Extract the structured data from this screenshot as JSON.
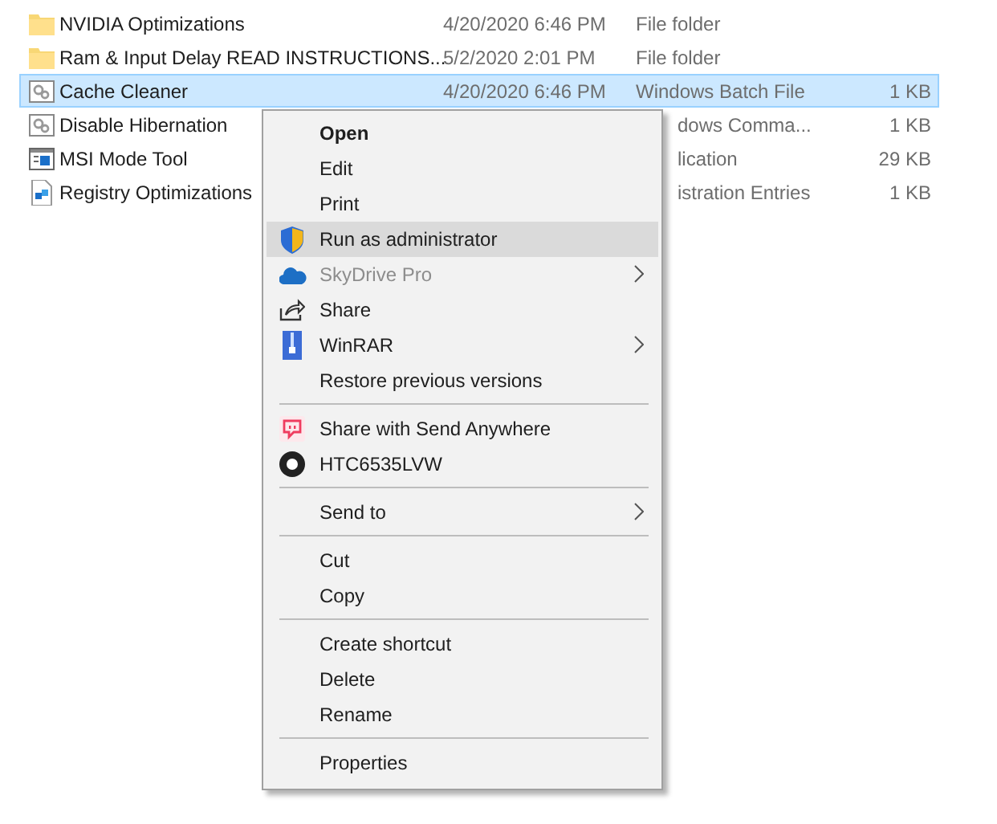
{
  "files": [
    {
      "name": "NVIDIA Optimizations",
      "date": "4/20/2020 6:46 PM",
      "type": "File folder",
      "selected": false
    },
    {
      "name": "Ram & Input Delay READ INSTRUCTIONS...",
      "date": "5/2/2020 2:01 PM",
      "type": "File folder",
      "selected": false
    },
    {
      "name": "Cache Cleaner",
      "date": "4/20/2020 6:46 PM",
      "type": "Windows Batch File",
      "size": "1 KB",
      "selected": true
    },
    {
      "name": "Disable Hibernation",
      "type": "dows Comma...",
      "size": "1 KB",
      "selected": false
    },
    {
      "name": "MSI Mode Tool",
      "type": "lication",
      "size": "29 KB",
      "selected": false
    },
    {
      "name": "Registry Optimizations",
      "type": "istration Entries",
      "size": "1 KB",
      "selected": false
    }
  ],
  "context_menu": {
    "items": [
      {
        "kind": "item",
        "label": "Open",
        "bold": true,
        "highlighted": false,
        "disabled": false,
        "submenu": false
      },
      {
        "kind": "item",
        "label": "Edit",
        "bold": false,
        "highlighted": false,
        "disabled": false,
        "submenu": false
      },
      {
        "kind": "item",
        "label": "Print",
        "bold": false,
        "highlighted": false,
        "disabled": false,
        "submenu": false
      },
      {
        "kind": "item",
        "label": "Run as administrator",
        "bold": false,
        "highlighted": true,
        "disabled": false,
        "submenu": false
      },
      {
        "kind": "item",
        "label": "SkyDrive Pro",
        "bold": false,
        "highlighted": false,
        "disabled": true,
        "submenu": true
      },
      {
        "kind": "item",
        "label": "Share",
        "bold": false,
        "highlighted": false,
        "disabled": false,
        "submenu": false
      },
      {
        "kind": "item",
        "label": "WinRAR",
        "bold": false,
        "highlighted": false,
        "disabled": false,
        "submenu": true
      },
      {
        "kind": "item",
        "label": "Restore previous versions",
        "bold": false,
        "highlighted": false,
        "disabled": false,
        "submenu": false
      },
      {
        "kind": "separator"
      },
      {
        "kind": "item",
        "label": "Share with Send Anywhere",
        "bold": false,
        "highlighted": false,
        "disabled": false,
        "submenu": false
      },
      {
        "kind": "item",
        "label": "HTC6535LVW",
        "bold": false,
        "highlighted": false,
        "disabled": false,
        "submenu": false
      },
      {
        "kind": "separator"
      },
      {
        "kind": "item",
        "label": "Send to",
        "bold": false,
        "highlighted": false,
        "disabled": false,
        "submenu": true
      },
      {
        "kind": "separator"
      },
      {
        "kind": "item",
        "label": "Cut",
        "bold": false,
        "highlighted": false,
        "disabled": false,
        "submenu": false
      },
      {
        "kind": "item",
        "label": "Copy",
        "bold": false,
        "highlighted": false,
        "disabled": false,
        "submenu": false
      },
      {
        "kind": "separator"
      },
      {
        "kind": "item",
        "label": "Create shortcut",
        "bold": false,
        "highlighted": false,
        "disabled": false,
        "submenu": false
      },
      {
        "kind": "item",
        "label": "Delete",
        "bold": false,
        "highlighted": false,
        "disabled": false,
        "submenu": false
      },
      {
        "kind": "item",
        "label": "Rename",
        "bold": false,
        "highlighted": false,
        "disabled": false,
        "submenu": false
      },
      {
        "kind": "separator"
      },
      {
        "kind": "item",
        "label": "Properties",
        "bold": false,
        "highlighted": false,
        "disabled": false,
        "submenu": false
      }
    ]
  }
}
